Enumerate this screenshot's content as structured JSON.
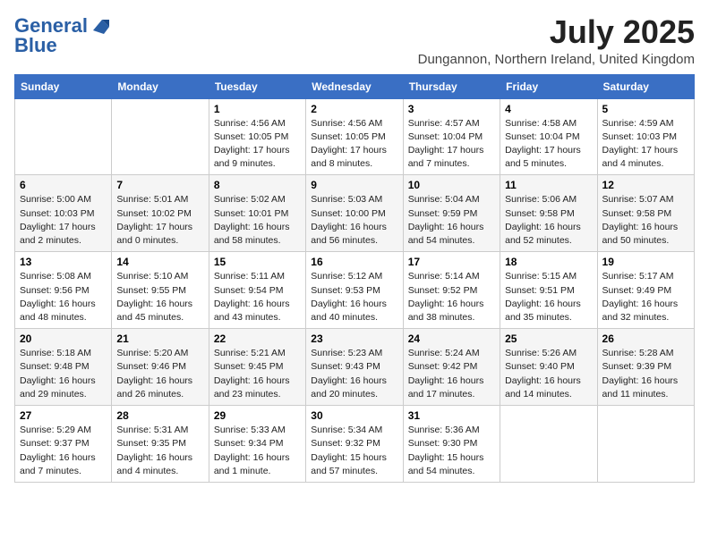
{
  "logo": {
    "line1": "General",
    "line2": "Blue"
  },
  "title": "July 2025",
  "location": "Dungannon, Northern Ireland, United Kingdom",
  "weekdays": [
    "Sunday",
    "Monday",
    "Tuesday",
    "Wednesday",
    "Thursday",
    "Friday",
    "Saturday"
  ],
  "weeks": [
    [
      {
        "day": "",
        "sunrise": "",
        "sunset": "",
        "daylight": ""
      },
      {
        "day": "",
        "sunrise": "",
        "sunset": "",
        "daylight": ""
      },
      {
        "day": "1",
        "sunrise": "Sunrise: 4:56 AM",
        "sunset": "Sunset: 10:05 PM",
        "daylight": "Daylight: 17 hours and 9 minutes."
      },
      {
        "day": "2",
        "sunrise": "Sunrise: 4:56 AM",
        "sunset": "Sunset: 10:05 PM",
        "daylight": "Daylight: 17 hours and 8 minutes."
      },
      {
        "day": "3",
        "sunrise": "Sunrise: 4:57 AM",
        "sunset": "Sunset: 10:04 PM",
        "daylight": "Daylight: 17 hours and 7 minutes."
      },
      {
        "day": "4",
        "sunrise": "Sunrise: 4:58 AM",
        "sunset": "Sunset: 10:04 PM",
        "daylight": "Daylight: 17 hours and 5 minutes."
      },
      {
        "day": "5",
        "sunrise": "Sunrise: 4:59 AM",
        "sunset": "Sunset: 10:03 PM",
        "daylight": "Daylight: 17 hours and 4 minutes."
      }
    ],
    [
      {
        "day": "6",
        "sunrise": "Sunrise: 5:00 AM",
        "sunset": "Sunset: 10:03 PM",
        "daylight": "Daylight: 17 hours and 2 minutes."
      },
      {
        "day": "7",
        "sunrise": "Sunrise: 5:01 AM",
        "sunset": "Sunset: 10:02 PM",
        "daylight": "Daylight: 17 hours and 0 minutes."
      },
      {
        "day": "8",
        "sunrise": "Sunrise: 5:02 AM",
        "sunset": "Sunset: 10:01 PM",
        "daylight": "Daylight: 16 hours and 58 minutes."
      },
      {
        "day": "9",
        "sunrise": "Sunrise: 5:03 AM",
        "sunset": "Sunset: 10:00 PM",
        "daylight": "Daylight: 16 hours and 56 minutes."
      },
      {
        "day": "10",
        "sunrise": "Sunrise: 5:04 AM",
        "sunset": "Sunset: 9:59 PM",
        "daylight": "Daylight: 16 hours and 54 minutes."
      },
      {
        "day": "11",
        "sunrise": "Sunrise: 5:06 AM",
        "sunset": "Sunset: 9:58 PM",
        "daylight": "Daylight: 16 hours and 52 minutes."
      },
      {
        "day": "12",
        "sunrise": "Sunrise: 5:07 AM",
        "sunset": "Sunset: 9:58 PM",
        "daylight": "Daylight: 16 hours and 50 minutes."
      }
    ],
    [
      {
        "day": "13",
        "sunrise": "Sunrise: 5:08 AM",
        "sunset": "Sunset: 9:56 PM",
        "daylight": "Daylight: 16 hours and 48 minutes."
      },
      {
        "day": "14",
        "sunrise": "Sunrise: 5:10 AM",
        "sunset": "Sunset: 9:55 PM",
        "daylight": "Daylight: 16 hours and 45 minutes."
      },
      {
        "day": "15",
        "sunrise": "Sunrise: 5:11 AM",
        "sunset": "Sunset: 9:54 PM",
        "daylight": "Daylight: 16 hours and 43 minutes."
      },
      {
        "day": "16",
        "sunrise": "Sunrise: 5:12 AM",
        "sunset": "Sunset: 9:53 PM",
        "daylight": "Daylight: 16 hours and 40 minutes."
      },
      {
        "day": "17",
        "sunrise": "Sunrise: 5:14 AM",
        "sunset": "Sunset: 9:52 PM",
        "daylight": "Daylight: 16 hours and 38 minutes."
      },
      {
        "day": "18",
        "sunrise": "Sunrise: 5:15 AM",
        "sunset": "Sunset: 9:51 PM",
        "daylight": "Daylight: 16 hours and 35 minutes."
      },
      {
        "day": "19",
        "sunrise": "Sunrise: 5:17 AM",
        "sunset": "Sunset: 9:49 PM",
        "daylight": "Daylight: 16 hours and 32 minutes."
      }
    ],
    [
      {
        "day": "20",
        "sunrise": "Sunrise: 5:18 AM",
        "sunset": "Sunset: 9:48 PM",
        "daylight": "Daylight: 16 hours and 29 minutes."
      },
      {
        "day": "21",
        "sunrise": "Sunrise: 5:20 AM",
        "sunset": "Sunset: 9:46 PM",
        "daylight": "Daylight: 16 hours and 26 minutes."
      },
      {
        "day": "22",
        "sunrise": "Sunrise: 5:21 AM",
        "sunset": "Sunset: 9:45 PM",
        "daylight": "Daylight: 16 hours and 23 minutes."
      },
      {
        "day": "23",
        "sunrise": "Sunrise: 5:23 AM",
        "sunset": "Sunset: 9:43 PM",
        "daylight": "Daylight: 16 hours and 20 minutes."
      },
      {
        "day": "24",
        "sunrise": "Sunrise: 5:24 AM",
        "sunset": "Sunset: 9:42 PM",
        "daylight": "Daylight: 16 hours and 17 minutes."
      },
      {
        "day": "25",
        "sunrise": "Sunrise: 5:26 AM",
        "sunset": "Sunset: 9:40 PM",
        "daylight": "Daylight: 16 hours and 14 minutes."
      },
      {
        "day": "26",
        "sunrise": "Sunrise: 5:28 AM",
        "sunset": "Sunset: 9:39 PM",
        "daylight": "Daylight: 16 hours and 11 minutes."
      }
    ],
    [
      {
        "day": "27",
        "sunrise": "Sunrise: 5:29 AM",
        "sunset": "Sunset: 9:37 PM",
        "daylight": "Daylight: 16 hours and 7 minutes."
      },
      {
        "day": "28",
        "sunrise": "Sunrise: 5:31 AM",
        "sunset": "Sunset: 9:35 PM",
        "daylight": "Daylight: 16 hours and 4 minutes."
      },
      {
        "day": "29",
        "sunrise": "Sunrise: 5:33 AM",
        "sunset": "Sunset: 9:34 PM",
        "daylight": "Daylight: 16 hours and 1 minute."
      },
      {
        "day": "30",
        "sunrise": "Sunrise: 5:34 AM",
        "sunset": "Sunset: 9:32 PM",
        "daylight": "Daylight: 15 hours and 57 minutes."
      },
      {
        "day": "31",
        "sunrise": "Sunrise: 5:36 AM",
        "sunset": "Sunset: 9:30 PM",
        "daylight": "Daylight: 15 hours and 54 minutes."
      },
      {
        "day": "",
        "sunrise": "",
        "sunset": "",
        "daylight": ""
      },
      {
        "day": "",
        "sunrise": "",
        "sunset": "",
        "daylight": ""
      }
    ]
  ]
}
